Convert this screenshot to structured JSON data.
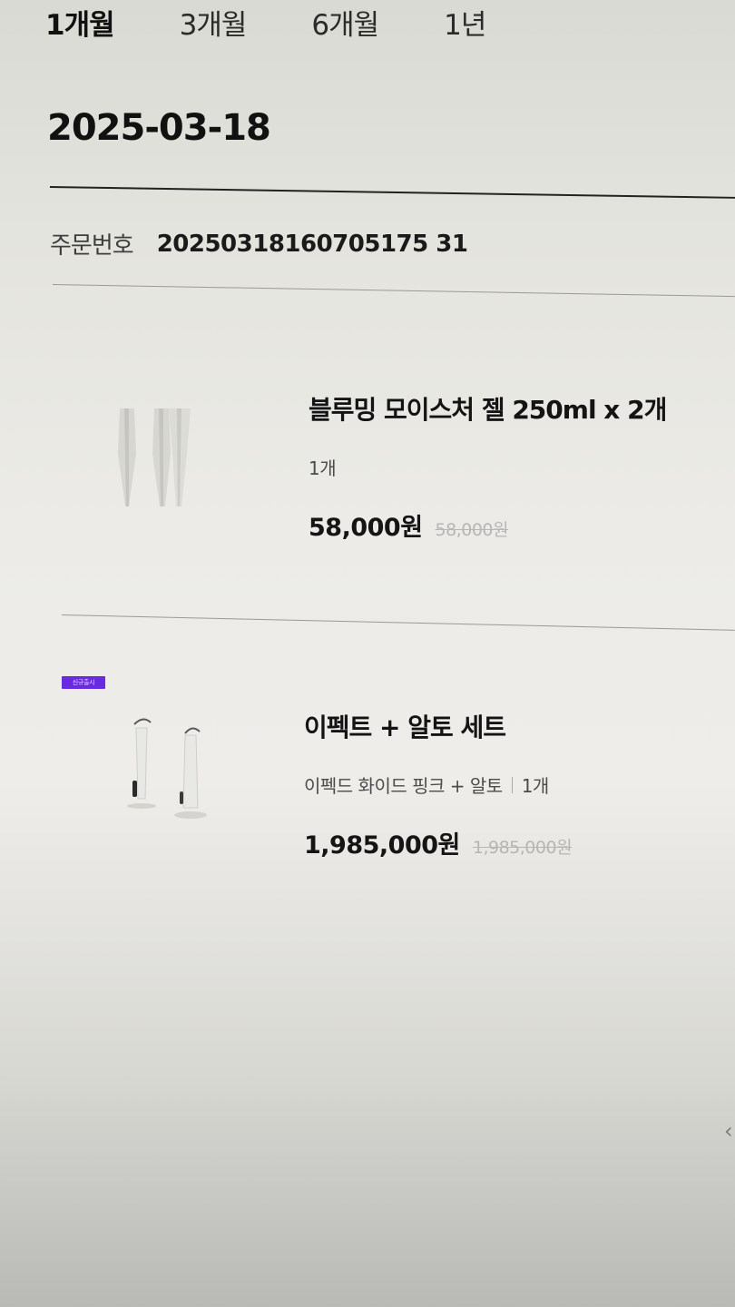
{
  "period_tabs": [
    {
      "label": "1개월",
      "active": true
    },
    {
      "label": "3개월",
      "active": false
    },
    {
      "label": "6개월",
      "active": false
    },
    {
      "label": "1년",
      "active": false
    }
  ],
  "order": {
    "date": "2025-03-18",
    "number_label": "주문번호",
    "number_value": "20250318160705175 31"
  },
  "items": [
    {
      "name": "블루밍 모이스처 젤 250ml x 2개",
      "option": "1개",
      "price": "58,000원",
      "original_price": "58,000원",
      "image_icon": "gel-tubes-image"
    },
    {
      "badge": "신규출시",
      "name": "이펙트 + 알토 세트",
      "option": "이펙드 화이드 핑크 + 알토",
      "quantity": "1개",
      "price": "1,985,000원",
      "original_price": "1,985,000원",
      "image_icon": "device-set-image"
    }
  ],
  "colors": {
    "badge": "#6a2ae0",
    "text": "#151515",
    "strike": "#b6b6b4"
  },
  "edge_icon": "chevron-left-icon"
}
